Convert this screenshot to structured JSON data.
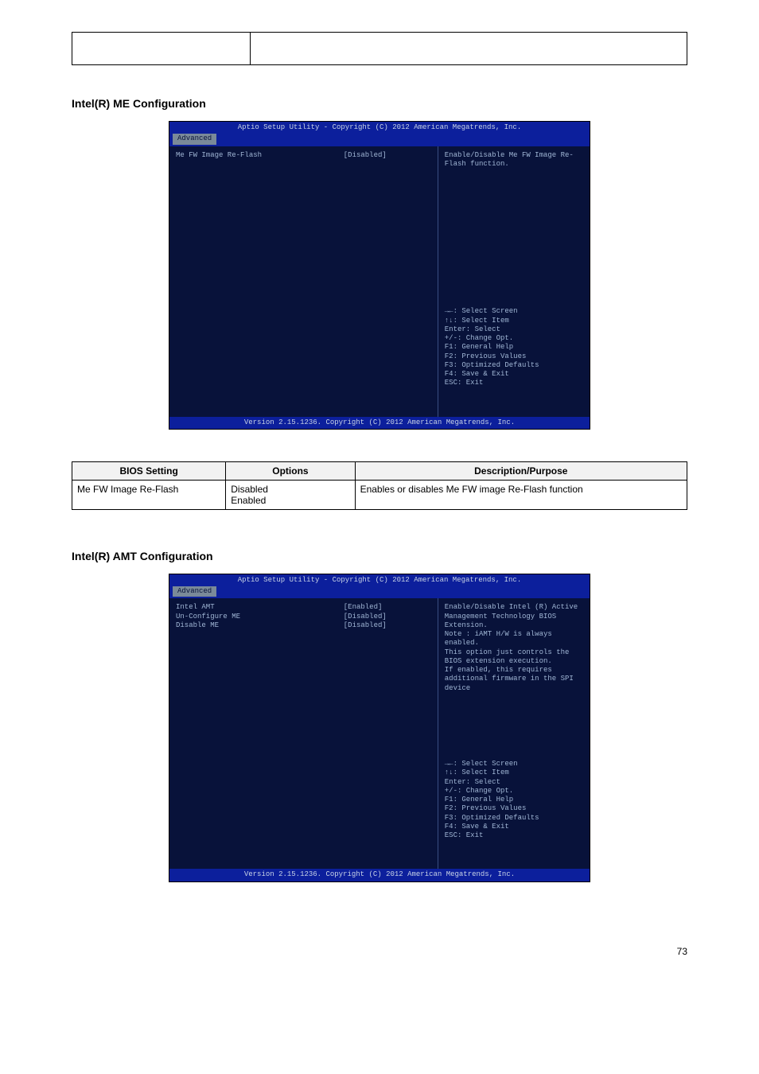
{
  "top_table": {
    "c1": "",
    "c2": ""
  },
  "section1": {
    "title": "Intel(R) ME Configuration",
    "bios": {
      "header": "Aptio Setup Utility - Copyright (C) 2012 American Megatrends, Inc.",
      "tab": "Advanced",
      "items": [
        {
          "label": "Me FW Image Re-Flash",
          "value": "[Disabled]"
        }
      ],
      "help": "Enable/Disable Me FW Image Re-Flash function.",
      "keys": [
        "→←: Select Screen",
        "↑↓: Select Item",
        "Enter: Select",
        "+/-: Change Opt.",
        "F1: General Help",
        "F2: Previous Values",
        "F3: Optimized Defaults",
        "F4: Save & Exit",
        "ESC: Exit"
      ],
      "footer": "Version 2.15.1236. Copyright (C) 2012 American Megatrends, Inc."
    },
    "desc_header": {
      "c1": "BIOS Setting",
      "c2": "Options",
      "c3": "Description/Purpose"
    },
    "desc_rows": [
      {
        "c1": "Me FW Image Re-Flash",
        "c2": "Disabled\nEnabled",
        "c3": "Enables or disables Me FW image Re-Flash function"
      }
    ]
  },
  "section2": {
    "title": "Intel(R) AMT Configuration",
    "bios": {
      "header": "Aptio Setup Utility - Copyright (C) 2012 American Megatrends, Inc.",
      "tab": "Advanced",
      "items": [
        {
          "label": "Intel AMT",
          "value": "[Enabled]"
        },
        {
          "label": "Un-Configure ME",
          "value": "[Disabled]"
        },
        {
          "label": "Disable ME",
          "value": "[Disabled]"
        }
      ],
      "help": "Enable/Disable Intel (R) Active Management Technology BIOS Extension.\nNote : iAMT H/W is always enabled.\nThis option just controls the BIOS extension execution.\nIf enabled, this requires additional firmware in the SPI device",
      "keys": [
        "→←: Select Screen",
        "↑↓: Select Item",
        "Enter: Select",
        "+/-: Change Opt.",
        "F1: General Help",
        "F2: Previous Values",
        "F3: Optimized Defaults",
        "F4: Save & Exit",
        "ESC: Exit"
      ],
      "footer": "Version 2.15.1236. Copyright (C) 2012 American Megatrends, Inc."
    }
  },
  "page_number": "73"
}
